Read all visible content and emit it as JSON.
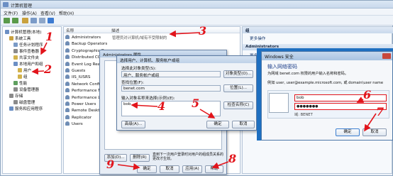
{
  "window": {
    "title": "计算机管理"
  },
  "menu": [
    "文件(F)",
    "操作(A)",
    "查看(V)",
    "帮助(H)"
  ],
  "tree": [
    {
      "label": "计算机管理(本地)",
      "indent": 0,
      "color": "#6b8fc4"
    },
    {
      "label": "系统工具",
      "indent": 1,
      "color": "#c9a13e"
    },
    {
      "label": "任务计划程序",
      "indent": 2,
      "color": "#7a9ac6"
    },
    {
      "label": "事件查看器",
      "indent": 2,
      "color": "#8a8a8a"
    },
    {
      "label": "共享文件夹",
      "indent": 2,
      "color": "#d2b24b"
    },
    {
      "label": "本地用户和组",
      "indent": 2,
      "color": "#6b8fc4"
    },
    {
      "label": "用户",
      "indent": 3,
      "color": "#d2b24b"
    },
    {
      "label": "组",
      "indent": 3,
      "color": "#d2b24b"
    },
    {
      "label": "性能",
      "indent": 2,
      "color": "#5f9f5f"
    },
    {
      "label": "设备管理器",
      "indent": 2,
      "color": "#8a8a8a"
    },
    {
      "label": "存储",
      "indent": 1,
      "color": "#8a8a8a"
    },
    {
      "label": "磁盘管理",
      "indent": 2,
      "color": "#8a8a8a"
    },
    {
      "label": "服务和应用程序",
      "indent": 1,
      "color": "#6b8fc4"
    }
  ],
  "list": {
    "headers": [
      "名称",
      "描述"
    ],
    "rows": [
      {
        "name": "Administrators",
        "desc": "管理员对计算机/域有不受限制的"
      },
      {
        "name": "Backup Operators",
        "desc": ""
      },
      {
        "name": "Cryptographic Oper...",
        "desc": ""
      },
      {
        "name": "Distributed COM Us...",
        "desc": ""
      },
      {
        "name": "Event Log Readers",
        "desc": ""
      },
      {
        "name": "Guests",
        "desc": ""
      },
      {
        "name": "IIS_IUSRS",
        "desc": ""
      },
      {
        "name": "Network Configurat...",
        "desc": ""
      },
      {
        "name": "Performance Monit...",
        "desc": ""
      },
      {
        "name": "Performance Log Us...",
        "desc": ""
      },
      {
        "name": "Power Users",
        "desc": ""
      },
      {
        "name": "Remote Desktop Us...",
        "desc": ""
      },
      {
        "name": "Replicator",
        "desc": ""
      },
      {
        "name": "Users",
        "desc": ""
      }
    ]
  },
  "actions": {
    "header1": "组",
    "item1": "更多操作",
    "header2": "Administrators",
    "item2": "更多操作"
  },
  "props": {
    "title": "Administrators 属性",
    "note": "直到下一次用户登录时对用户的组成员关系的更改才生效。",
    "ok": "确定",
    "cancel": "取消",
    "apply": "应用(A)",
    "help": "帮助",
    "add": "添加(D)...",
    "remove": "删除(R)"
  },
  "select": {
    "title": "选择用户、计算机、服务帐户或组",
    "type_label": "选择此对象类型(S):",
    "type_value": "用户、服务帐户或组",
    "type_btn": "对象类型(O)...",
    "loc_label": "查找位置(F):",
    "loc_value": "benet.com",
    "loc_btn": "位置(L)...",
    "name_label": "输入对象名称来选择(示例)(E):",
    "name_value": "bob",
    "check_btn": "检查名称(C)",
    "adv_btn": "高级(A)...",
    "ok": "确定",
    "cancel": "取消"
  },
  "security": {
    "title": "Windows 安全",
    "heading": "输入网络密码",
    "desc": "为网域 benet.com 权限的用户输入名称和密码。",
    "example": "例如 user, user@example.microsoft.com, 或 domain\\user name",
    "username": "bob",
    "password": "●●●●●●●",
    "domain": "域: BENET",
    "ok": "确定",
    "cancel": "取消"
  },
  "annotations": [
    "1",
    "2",
    "3",
    "4",
    "5",
    "6",
    "7",
    "8",
    "9"
  ],
  "colors": {
    "annotation": "#e2141b",
    "accent": "#1e6fc0"
  }
}
